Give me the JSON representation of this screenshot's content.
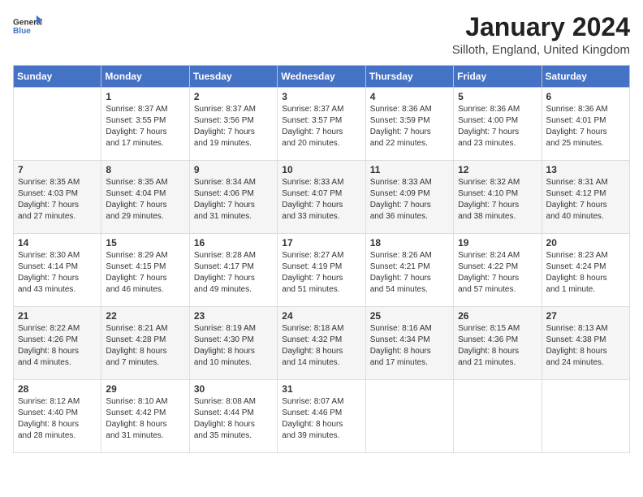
{
  "header": {
    "logo_general": "General",
    "logo_blue": "Blue",
    "title": "January 2024",
    "location": "Silloth, England, United Kingdom"
  },
  "days_of_week": [
    "Sunday",
    "Monday",
    "Tuesday",
    "Wednesday",
    "Thursday",
    "Friday",
    "Saturday"
  ],
  "weeks": [
    [
      {
        "day": "",
        "info": ""
      },
      {
        "day": "1",
        "info": "Sunrise: 8:37 AM\nSunset: 3:55 PM\nDaylight: 7 hours\nand 17 minutes."
      },
      {
        "day": "2",
        "info": "Sunrise: 8:37 AM\nSunset: 3:56 PM\nDaylight: 7 hours\nand 19 minutes."
      },
      {
        "day": "3",
        "info": "Sunrise: 8:37 AM\nSunset: 3:57 PM\nDaylight: 7 hours\nand 20 minutes."
      },
      {
        "day": "4",
        "info": "Sunrise: 8:36 AM\nSunset: 3:59 PM\nDaylight: 7 hours\nand 22 minutes."
      },
      {
        "day": "5",
        "info": "Sunrise: 8:36 AM\nSunset: 4:00 PM\nDaylight: 7 hours\nand 23 minutes."
      },
      {
        "day": "6",
        "info": "Sunrise: 8:36 AM\nSunset: 4:01 PM\nDaylight: 7 hours\nand 25 minutes."
      }
    ],
    [
      {
        "day": "7",
        "info": "Sunrise: 8:35 AM\nSunset: 4:03 PM\nDaylight: 7 hours\nand 27 minutes."
      },
      {
        "day": "8",
        "info": "Sunrise: 8:35 AM\nSunset: 4:04 PM\nDaylight: 7 hours\nand 29 minutes."
      },
      {
        "day": "9",
        "info": "Sunrise: 8:34 AM\nSunset: 4:06 PM\nDaylight: 7 hours\nand 31 minutes."
      },
      {
        "day": "10",
        "info": "Sunrise: 8:33 AM\nSunset: 4:07 PM\nDaylight: 7 hours\nand 33 minutes."
      },
      {
        "day": "11",
        "info": "Sunrise: 8:33 AM\nSunset: 4:09 PM\nDaylight: 7 hours\nand 36 minutes."
      },
      {
        "day": "12",
        "info": "Sunrise: 8:32 AM\nSunset: 4:10 PM\nDaylight: 7 hours\nand 38 minutes."
      },
      {
        "day": "13",
        "info": "Sunrise: 8:31 AM\nSunset: 4:12 PM\nDaylight: 7 hours\nand 40 minutes."
      }
    ],
    [
      {
        "day": "14",
        "info": "Sunrise: 8:30 AM\nSunset: 4:14 PM\nDaylight: 7 hours\nand 43 minutes."
      },
      {
        "day": "15",
        "info": "Sunrise: 8:29 AM\nSunset: 4:15 PM\nDaylight: 7 hours\nand 46 minutes."
      },
      {
        "day": "16",
        "info": "Sunrise: 8:28 AM\nSunset: 4:17 PM\nDaylight: 7 hours\nand 49 minutes."
      },
      {
        "day": "17",
        "info": "Sunrise: 8:27 AM\nSunset: 4:19 PM\nDaylight: 7 hours\nand 51 minutes."
      },
      {
        "day": "18",
        "info": "Sunrise: 8:26 AM\nSunset: 4:21 PM\nDaylight: 7 hours\nand 54 minutes."
      },
      {
        "day": "19",
        "info": "Sunrise: 8:24 AM\nSunset: 4:22 PM\nDaylight: 7 hours\nand 57 minutes."
      },
      {
        "day": "20",
        "info": "Sunrise: 8:23 AM\nSunset: 4:24 PM\nDaylight: 8 hours\nand 1 minute."
      }
    ],
    [
      {
        "day": "21",
        "info": "Sunrise: 8:22 AM\nSunset: 4:26 PM\nDaylight: 8 hours\nand 4 minutes."
      },
      {
        "day": "22",
        "info": "Sunrise: 8:21 AM\nSunset: 4:28 PM\nDaylight: 8 hours\nand 7 minutes."
      },
      {
        "day": "23",
        "info": "Sunrise: 8:19 AM\nSunset: 4:30 PM\nDaylight: 8 hours\nand 10 minutes."
      },
      {
        "day": "24",
        "info": "Sunrise: 8:18 AM\nSunset: 4:32 PM\nDaylight: 8 hours\nand 14 minutes."
      },
      {
        "day": "25",
        "info": "Sunrise: 8:16 AM\nSunset: 4:34 PM\nDaylight: 8 hours\nand 17 minutes."
      },
      {
        "day": "26",
        "info": "Sunrise: 8:15 AM\nSunset: 4:36 PM\nDaylight: 8 hours\nand 21 minutes."
      },
      {
        "day": "27",
        "info": "Sunrise: 8:13 AM\nSunset: 4:38 PM\nDaylight: 8 hours\nand 24 minutes."
      }
    ],
    [
      {
        "day": "28",
        "info": "Sunrise: 8:12 AM\nSunset: 4:40 PM\nDaylight: 8 hours\nand 28 minutes."
      },
      {
        "day": "29",
        "info": "Sunrise: 8:10 AM\nSunset: 4:42 PM\nDaylight: 8 hours\nand 31 minutes."
      },
      {
        "day": "30",
        "info": "Sunrise: 8:08 AM\nSunset: 4:44 PM\nDaylight: 8 hours\nand 35 minutes."
      },
      {
        "day": "31",
        "info": "Sunrise: 8:07 AM\nSunset: 4:46 PM\nDaylight: 8 hours\nand 39 minutes."
      },
      {
        "day": "",
        "info": ""
      },
      {
        "day": "",
        "info": ""
      },
      {
        "day": "",
        "info": ""
      }
    ]
  ]
}
